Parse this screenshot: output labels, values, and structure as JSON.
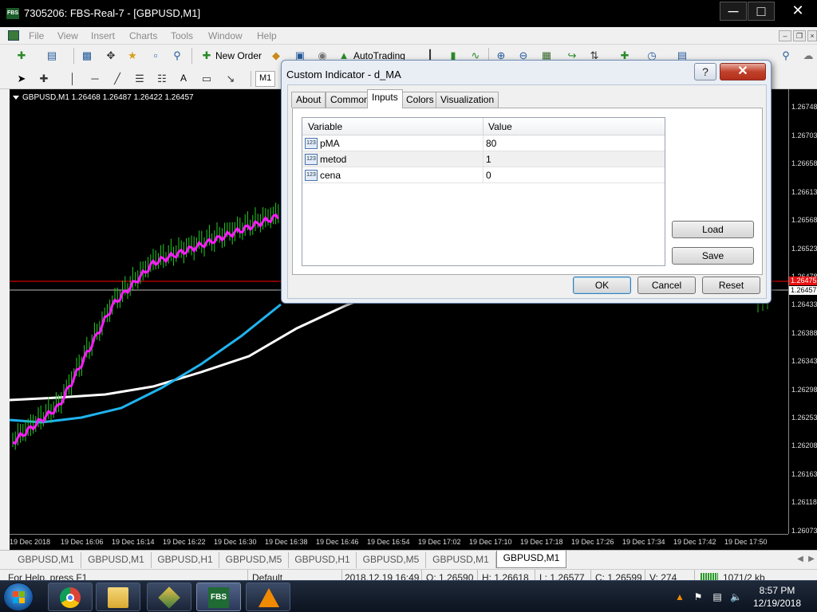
{
  "window": {
    "title": "7305206: FBS-Real-7 - [GBPUSD,M1]",
    "app_icon": "FBS",
    "minimize_icon": "minimize-icon",
    "maximize_icon": "maximize-icon",
    "close_icon": "close-icon"
  },
  "menu": [
    "File",
    "View",
    "Insert",
    "Charts",
    "Tools",
    "Window",
    "Help"
  ],
  "toolbar": {
    "new_order": "New Order",
    "autotrading": "AutoTrading",
    "timeframe": "M1",
    "text_tool": "A"
  },
  "chart": {
    "header": "GBPUSD,M1  1.26468 1.26487 1.26422 1.26457",
    "price_labels": [
      "1.26748",
      "1.26703",
      "1.26658",
      "1.26613",
      "1.26568",
      "1.26523",
      "1.26478",
      "1.26433",
      "1.26388",
      "1.26343",
      "1.26298",
      "1.26253",
      "1.26208",
      "1.26163",
      "1.26118",
      "1.26073"
    ],
    "ask_tag": "1.26475",
    "bid_tag": "1.26457",
    "time_labels": [
      "19 Dec 2018",
      "19 Dec 16:06",
      "19 Dec 16:14",
      "19 Dec 16:22",
      "19 Dec 16:30",
      "19 Dec 16:38",
      "19 Dec 16:46",
      "19 Dec 16:54",
      "19 Dec 17:02",
      "19 Dec 17:10",
      "19 Dec 17:18",
      "19 Dec 17:26",
      "19 Dec 17:34",
      "19 Dec 17:42",
      "19 Dec 17:50"
    ],
    "colors": {
      "magenta_ma": "#ff1aff",
      "blue_ma": "#1fb4ef",
      "white_ma": "#ffffff",
      "price_bars": "#22cc22",
      "ask_line": "#ff0000"
    }
  },
  "chart_tabs": [
    "GBPUSD,M1",
    "GBPUSD,M1",
    "GBPUSD,H1",
    "GBPUSD,M5",
    "GBPUSD,H1",
    "GBPUSD,M5",
    "GBPUSD,M1",
    "GBPUSD,M1"
  ],
  "status": {
    "help": "For Help, press F1",
    "profile": "Default",
    "datetime": "2018.12.19 16:49",
    "open": "O: 1.26590",
    "high": "H: 1.26618",
    "low": "L: 1.26577",
    "close": "C: 1.26599",
    "volume": "V: 274",
    "traffic": "1071/2 kb"
  },
  "dialog": {
    "title": "Custom Indicator - d_MA",
    "help": "?",
    "close": "✕",
    "tabs": [
      "About",
      "Common",
      "Inputs",
      "Colors",
      "Visualization"
    ],
    "active_tab": "Inputs",
    "columns": {
      "variable": "Variable",
      "value": "Value"
    },
    "row_icon": "123",
    "rows": [
      {
        "variable": "pMA",
        "value": "80"
      },
      {
        "variable": "metod",
        "value": "1"
      },
      {
        "variable": "cena",
        "value": "0"
      }
    ],
    "load": "Load",
    "save": "Save",
    "ok": "OK",
    "cancel": "Cancel",
    "reset": "Reset"
  },
  "taskbar": {
    "time": "8:57 PM",
    "date": "12/19/2018",
    "fbs_label": "FBS"
  }
}
